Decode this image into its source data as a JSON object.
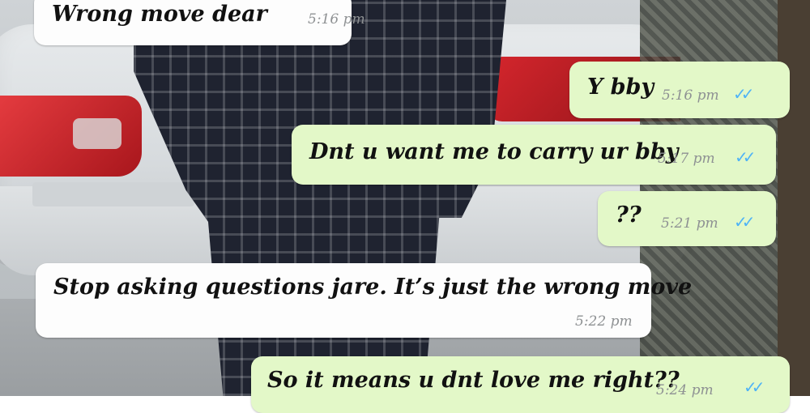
{
  "chat": {
    "messages": [
      {
        "direction": "incoming",
        "text": "Wrong move dear",
        "time": "5:16 pm"
      },
      {
        "direction": "outgoing",
        "text": "Y bby",
        "time": "5:16 pm",
        "status": "read",
        "ticks": "✓✓"
      },
      {
        "direction": "outgoing",
        "text": "Dnt u want me to carry ur bby",
        "time": "5:17 pm",
        "status": "read",
        "ticks": "✓✓"
      },
      {
        "direction": "outgoing",
        "text": "??",
        "time": "5:21 pm",
        "status": "read",
        "ticks": "✓✓"
      },
      {
        "direction": "incoming",
        "text": "Stop asking questions jare. It’s just the wrong move",
        "time": "5:22 pm"
      },
      {
        "direction": "outgoing",
        "text": "So it means u dnt love me right??",
        "time": "5:24 pm",
        "status": "read",
        "ticks": "✓✓"
      }
    ]
  },
  "colors": {
    "incoming_bubble": "#fdfdfd",
    "outgoing_bubble": "#e3f8c8",
    "read_ticks": "#4fb3f6",
    "timestamp": "#8e9193"
  },
  "icons": {
    "read_receipt": "double-check-icon"
  }
}
